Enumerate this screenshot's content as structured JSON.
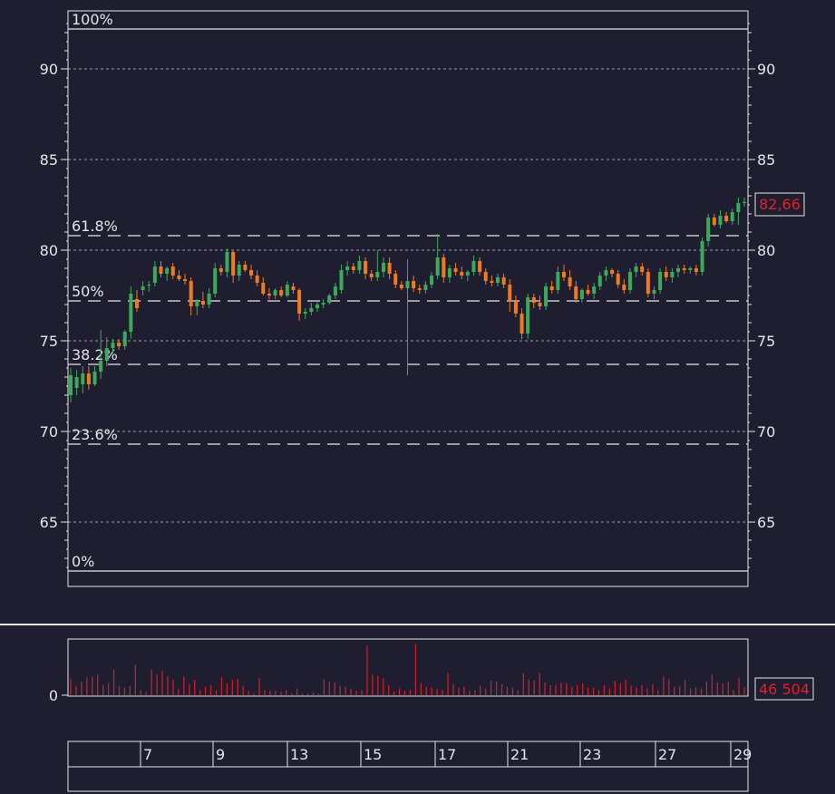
{
  "colors": {
    "background": "#1e1e30",
    "frame": "#e6e6e6",
    "grid": "#9a9aa8",
    "up": "#3caa5a",
    "down": "#f07a1e",
    "volume": "#c8202a",
    "last_value": "#e0202a"
  },
  "chart_data": [
    {
      "type": "candlestick",
      "title": "",
      "xlabel": "",
      "ylabel": "",
      "ylim": [
        62,
        93
      ],
      "yticks": [
        "65",
        "70",
        "75",
        "80",
        "85",
        "90"
      ],
      "grid": true,
      "last_value_label": "82,66",
      "fibonacci": [
        {
          "label": "100%",
          "value": 92.2
        },
        {
          "label": "61.8%",
          "value": 80.8
        },
        {
          "label": "50%",
          "value": 77.2
        },
        {
          "label": "38.2%",
          "value": 73.7
        },
        {
          "label": "23.6%",
          "value": 69.3
        },
        {
          "label": "0%",
          "value": 62.3
        }
      ],
      "candles": [
        [
          72.0,
          73.5,
          71.6,
          73.1
        ],
        [
          72.4,
          73.4,
          72.0,
          73.0
        ],
        [
          72.6,
          73.6,
          72.1,
          73.2
        ],
        [
          73.2,
          73.6,
          72.3,
          72.6
        ],
        [
          72.6,
          73.6,
          72.5,
          73.3
        ],
        [
          73.3,
          75.6,
          72.9,
          73.9
        ],
        [
          73.9,
          75.2,
          73.6,
          74.6
        ],
        [
          74.6,
          75.1,
          74.3,
          74.9
        ],
        [
          74.9,
          75.1,
          74.5,
          74.7
        ],
        [
          74.7,
          75.6,
          74.5,
          75.5
        ],
        [
          75.5,
          78.0,
          75.1,
          77.6
        ],
        [
          77.3,
          77.8,
          76.6,
          76.8
        ],
        [
          77.8,
          78.3,
          77.5,
          78.0
        ],
        [
          78.1,
          78.3,
          77.7,
          78.1
        ],
        [
          78.2,
          79.4,
          78.0,
          79.1
        ],
        [
          79.1,
          79.4,
          78.5,
          78.7
        ],
        [
          78.7,
          79.1,
          78.3,
          79.0
        ],
        [
          79.1,
          79.3,
          78.4,
          78.6
        ],
        [
          78.6,
          78.9,
          78.3,
          78.4
        ],
        [
          78.4,
          78.7,
          78.1,
          78.3
        ],
        [
          78.3,
          78.5,
          76.4,
          76.9
        ],
        [
          76.9,
          77.3,
          76.4,
          77.2
        ],
        [
          77.2,
          77.7,
          76.8,
          77.0
        ],
        [
          77.0,
          77.9,
          76.8,
          77.6
        ],
        [
          77.6,
          79.3,
          77.4,
          79.0
        ],
        [
          79.0,
          79.2,
          78.6,
          78.8
        ],
        [
          78.8,
          80.1,
          78.5,
          79.9
        ],
        [
          79.9,
          80.0,
          78.2,
          78.6
        ],
        [
          78.6,
          79.4,
          78.3,
          79.2
        ],
        [
          79.2,
          79.4,
          78.8,
          78.9
        ],
        [
          78.9,
          79.2,
          78.4,
          78.6
        ],
        [
          78.6,
          78.9,
          78.0,
          78.2
        ],
        [
          78.2,
          78.5,
          77.5,
          77.6
        ],
        [
          77.6,
          77.9,
          77.3,
          77.5
        ],
        [
          77.5,
          77.9,
          77.3,
          77.8
        ],
        [
          77.8,
          78.0,
          77.4,
          77.5
        ],
        [
          77.5,
          78.3,
          77.4,
          78.1
        ],
        [
          78.0,
          78.2,
          77.6,
          77.8
        ],
        [
          77.8,
          77.9,
          76.1,
          76.5
        ],
        [
          76.5,
          76.8,
          76.2,
          76.6
        ],
        [
          76.6,
          77.1,
          76.4,
          76.8
        ],
        [
          76.8,
          77.2,
          76.6,
          77.0
        ],
        [
          77.0,
          77.3,
          76.8,
          77.1
        ],
        [
          77.1,
          77.6,
          77.0,
          77.5
        ],
        [
          77.5,
          78.2,
          77.3,
          78.0
        ],
        [
          77.8,
          79.2,
          77.6,
          78.9
        ],
        [
          78.9,
          79.4,
          78.6,
          79.1
        ],
        [
          79.1,
          79.3,
          78.7,
          78.9
        ],
        [
          78.9,
          79.7,
          78.7,
          79.4
        ],
        [
          79.4,
          79.6,
          78.4,
          78.7
        ],
        [
          78.7,
          78.9,
          78.3,
          78.5
        ],
        [
          78.5,
          80.0,
          78.3,
          78.8
        ],
        [
          78.8,
          79.6,
          78.5,
          79.3
        ],
        [
          79.3,
          79.6,
          78.4,
          78.7
        ],
        [
          78.7,
          78.9,
          77.9,
          78.1
        ],
        [
          78.1,
          78.3,
          77.8,
          77.9
        ],
        [
          77.9,
          79.5,
          73.1,
          78.3
        ],
        [
          78.3,
          78.6,
          77.7,
          77.9
        ],
        [
          77.9,
          78.1,
          77.6,
          77.8
        ],
        [
          77.8,
          78.3,
          77.6,
          78.1
        ],
        [
          78.1,
          78.8,
          77.9,
          78.6
        ],
        [
          78.6,
          80.9,
          78.4,
          79.6
        ],
        [
          79.6,
          79.8,
          78.2,
          78.5
        ],
        [
          78.5,
          79.2,
          78.2,
          79.0
        ],
        [
          79.0,
          79.3,
          78.6,
          78.8
        ],
        [
          78.8,
          79.1,
          78.4,
          78.6
        ],
        [
          78.6,
          78.9,
          78.3,
          78.8
        ],
        [
          78.8,
          79.7,
          78.6,
          79.4
        ],
        [
          79.4,
          79.6,
          78.6,
          78.8
        ],
        [
          78.8,
          79.0,
          78.1,
          78.3
        ],
        [
          78.3,
          78.6,
          78.0,
          78.2
        ],
        [
          78.2,
          78.7,
          78.0,
          78.5
        ],
        [
          78.5,
          78.7,
          77.9,
          78.1
        ],
        [
          78.1,
          78.4,
          76.6,
          77.2
        ],
        [
          77.2,
          77.5,
          76.3,
          76.5
        ],
        [
          76.5,
          76.8,
          75.1,
          75.4
        ],
        [
          75.4,
          77.6,
          75.1,
          77.4
        ],
        [
          77.4,
          77.6,
          76.8,
          77.1
        ],
        [
          77.1,
          77.5,
          76.7,
          76.9
        ],
        [
          76.9,
          78.2,
          76.7,
          78.0
        ],
        [
          78.0,
          78.3,
          77.6,
          77.8
        ],
        [
          77.8,
          79.1,
          77.6,
          78.8
        ],
        [
          78.8,
          79.2,
          78.3,
          78.5
        ],
        [
          78.5,
          78.9,
          77.8,
          78.0
        ],
        [
          78.0,
          78.3,
          77.1,
          77.3
        ],
        [
          77.3,
          77.9,
          77.1,
          77.8
        ],
        [
          77.8,
          78.1,
          77.5,
          77.6
        ],
        [
          77.6,
          78.2,
          77.3,
          78.0
        ],
        [
          78.0,
          78.8,
          77.8,
          78.6
        ],
        [
          78.6,
          79.1,
          78.3,
          78.9
        ],
        [
          78.9,
          79.0,
          78.5,
          78.7
        ],
        [
          78.7,
          78.9,
          77.9,
          78.1
        ],
        [
          78.1,
          78.4,
          77.6,
          77.8
        ],
        [
          77.8,
          79.0,
          77.6,
          78.8
        ],
        [
          78.8,
          79.3,
          78.5,
          79.1
        ],
        [
          79.1,
          79.3,
          78.6,
          78.8
        ],
        [
          78.8,
          79.0,
          77.4,
          77.6
        ],
        [
          77.6,
          78.0,
          77.3,
          77.8
        ],
        [
          77.8,
          79.0,
          77.6,
          78.8
        ],
        [
          78.8,
          79.1,
          78.3,
          78.5
        ],
        [
          78.5,
          79.0,
          78.2,
          78.8
        ],
        [
          78.8,
          79.2,
          78.5,
          79.0
        ],
        [
          79.0,
          79.2,
          78.7,
          78.9
        ],
        [
          78.9,
          79.1,
          78.7,
          79.0
        ],
        [
          79.0,
          79.2,
          78.6,
          78.8
        ],
        [
          78.8,
          80.7,
          78.6,
          80.5
        ],
        [
          80.5,
          82.0,
          80.2,
          81.8
        ],
        [
          81.8,
          82.0,
          81.3,
          81.4
        ],
        [
          81.4,
          82.2,
          81.2,
          81.9
        ],
        [
          81.9,
          82.1,
          81.5,
          81.6
        ],
        [
          81.6,
          82.3,
          81.4,
          82.1
        ],
        [
          82.1,
          82.9,
          81.4,
          82.6
        ],
        [
          82.6,
          82.9,
          82.4,
          82.66
        ]
      ]
    },
    {
      "type": "bar",
      "title": "",
      "ylabel": "",
      "ylim": [
        0,
        330000
      ],
      "yticks": [
        "0"
      ],
      "last_value_label": "46 504",
      "values": [
        95000,
        55000,
        80000,
        105000,
        110000,
        120000,
        60000,
        70000,
        150000,
        55000,
        45000,
        55000,
        180000,
        30000,
        20000,
        150000,
        120000,
        145000,
        110000,
        90000,
        40000,
        110000,
        65000,
        90000,
        30000,
        50000,
        60000,
        30000,
        105000,
        70000,
        90000,
        95000,
        55000,
        25000,
        10000,
        100000,
        30000,
        25000,
        25000,
        20000,
        30000,
        10000,
        40000,
        10000,
        10000,
        15000,
        10000,
        95000,
        80000,
        75000,
        55000,
        50000,
        40000,
        25000,
        30000,
        290000,
        120000,
        115000,
        100000,
        60000,
        20000,
        40000,
        25000,
        30000,
        300000,
        70000,
        50000,
        45000,
        40000,
        30000,
        130000,
        65000,
        45000,
        50000,
        25000,
        30000,
        55000,
        40000,
        85000,
        80000,
        65000,
        50000,
        45000,
        30000,
        130000,
        95000,
        85000,
        130000,
        75000,
        60000,
        60000,
        75000,
        70000,
        50000,
        60000,
        70000,
        45000,
        45000,
        30000,
        60000,
        40000,
        85000,
        70000,
        90000,
        55000,
        45000,
        60000,
        40000,
        65000,
        30000,
        110000,
        95000,
        50000,
        55000,
        90000,
        40000,
        45000,
        40000,
        80000,
        120000,
        75000,
        70000,
        80000,
        30000,
        100000,
        46504
      ]
    }
  ],
  "xaxis": {
    "tick_labels": [
      "7",
      "9",
      "13",
      "15",
      "17",
      "21",
      "23",
      "27",
      "29"
    ]
  }
}
